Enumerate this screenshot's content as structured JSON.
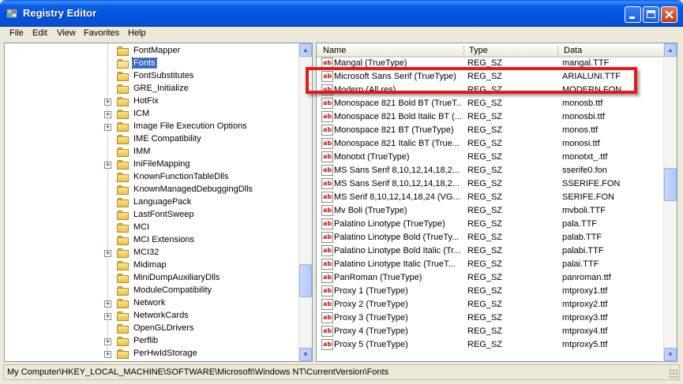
{
  "window": {
    "title": "Registry Editor"
  },
  "menu": [
    "File",
    "Edit",
    "View",
    "Favorites",
    "Help"
  ],
  "tree": {
    "items": [
      {
        "label": "FontMapper",
        "expandable": false,
        "selected": false
      },
      {
        "label": "Fonts",
        "expandable": false,
        "selected": true
      },
      {
        "label": "FontSubstitutes",
        "expandable": false,
        "selected": false
      },
      {
        "label": "GRE_Initialize",
        "expandable": false,
        "selected": false
      },
      {
        "label": "HotFix",
        "expandable": true,
        "selected": false
      },
      {
        "label": "ICM",
        "expandable": true,
        "selected": false
      },
      {
        "label": "Image File Execution Options",
        "expandable": true,
        "selected": false
      },
      {
        "label": "IME Compatibility",
        "expandable": false,
        "selected": false
      },
      {
        "label": "IMM",
        "expandable": false,
        "selected": false
      },
      {
        "label": "IniFileMapping",
        "expandable": true,
        "selected": false
      },
      {
        "label": "KnownFunctionTableDlls",
        "expandable": false,
        "selected": false
      },
      {
        "label": "KnownManagedDebuggingDlls",
        "expandable": false,
        "selected": false
      },
      {
        "label": "LanguagePack",
        "expandable": false,
        "selected": false
      },
      {
        "label": "LastFontSweep",
        "expandable": false,
        "selected": false
      },
      {
        "label": "MCI",
        "expandable": false,
        "selected": false
      },
      {
        "label": "MCI Extensions",
        "expandable": false,
        "selected": false
      },
      {
        "label": "MCI32",
        "expandable": true,
        "selected": false
      },
      {
        "label": "Midimap",
        "expandable": false,
        "selected": false
      },
      {
        "label": "MiniDumpAuxiliaryDlls",
        "expandable": false,
        "selected": false
      },
      {
        "label": "ModuleCompatibility",
        "expandable": false,
        "selected": false
      },
      {
        "label": "Network",
        "expandable": true,
        "selected": false
      },
      {
        "label": "NetworkCards",
        "expandable": true,
        "selected": false
      },
      {
        "label": "OpenGLDrivers",
        "expandable": false,
        "selected": false
      },
      {
        "label": "Perflib",
        "expandable": true,
        "selected": false
      },
      {
        "label": "PerHwIdStorage",
        "expandable": true,
        "selected": false
      }
    ]
  },
  "list": {
    "columns": [
      "Name",
      "Type",
      "Data"
    ],
    "rows": [
      {
        "name": "Mangal (TrueType)",
        "type": "REG_SZ",
        "data": "mangal.TTF"
      },
      {
        "name": "Microsoft Sans Serif (TrueType)",
        "type": "REG_SZ",
        "data": "ARIALUNI.TTF"
      },
      {
        "name": "Modern (All res)",
        "type": "REG_SZ",
        "data": "MODERN.FON"
      },
      {
        "name": "Monospace 821 Bold BT (TrueT...",
        "type": "REG_SZ",
        "data": "monosb.ttf"
      },
      {
        "name": "Monospace 821 Bold Italic BT (...",
        "type": "REG_SZ",
        "data": "monosbi.ttf"
      },
      {
        "name": "Monospace 821 BT (TrueType)",
        "type": "REG_SZ",
        "data": "monos.ttf"
      },
      {
        "name": "Monospace 821 Italic BT (True...",
        "type": "REG_SZ",
        "data": "monosi.ttf"
      },
      {
        "name": "Monotxt (TrueType)",
        "type": "REG_SZ",
        "data": "monotxt_.ttf"
      },
      {
        "name": "MS Sans Serif 8,10,12,14,18,2...",
        "type": "REG_SZ",
        "data": "sserife0.fon"
      },
      {
        "name": "MS Sans Serif 8,10,12,14,18,2...",
        "type": "REG_SZ",
        "data": "SSERIFE.FON"
      },
      {
        "name": "MS Serif 8,10,12,14,18,24 (VG...",
        "type": "REG_SZ",
        "data": "SERIFE.FON"
      },
      {
        "name": "Mv Boli (TrueType)",
        "type": "REG_SZ",
        "data": "mvboli.TTF"
      },
      {
        "name": "Palatino Linotype (TrueType)",
        "type": "REG_SZ",
        "data": "pala.TTF"
      },
      {
        "name": "Palatino Linotype Bold (TrueTy...",
        "type": "REG_SZ",
        "data": "palab.TTF"
      },
      {
        "name": "Palatino Linotype Bold Italic (Tr...",
        "type": "REG_SZ",
        "data": "palabi.TTF"
      },
      {
        "name": "Palatino Linotype Italic (TrueT...",
        "type": "REG_SZ",
        "data": "palai.TTF"
      },
      {
        "name": "PanRoman (TrueType)",
        "type": "REG_SZ",
        "data": "panroman.ttf"
      },
      {
        "name": "Proxy 1 (TrueType)",
        "type": "REG_SZ",
        "data": "mtproxy1.ttf"
      },
      {
        "name": "Proxy 2 (TrueType)",
        "type": "REG_SZ",
        "data": "mtproxy2.ttf"
      },
      {
        "name": "Proxy 3 (TrueType)",
        "type": "REG_SZ",
        "data": "mtproxy3.ttf"
      },
      {
        "name": "Proxy 4 (TrueType)",
        "type": "REG_SZ",
        "data": "mtproxy4.ttf"
      },
      {
        "name": "Proxy 5 (TrueType)",
        "type": "REG_SZ",
        "data": "mtproxy5.ttf"
      }
    ],
    "icon_text": "ab",
    "highlight_color": "#e81818"
  },
  "status": {
    "path": "My Computer\\HKEY_LOCAL_MACHINE\\SOFTWARE\\Microsoft\\Windows NT\\CurrentVersion\\Fonts"
  },
  "colors": {
    "title_blue": "#0054e3",
    "selection": "#316ac5"
  }
}
